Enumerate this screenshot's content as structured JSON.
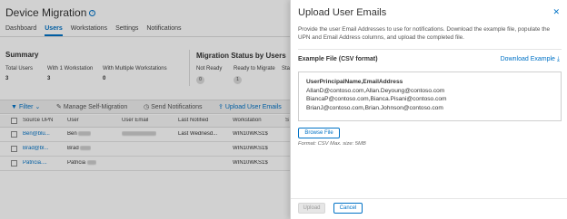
{
  "page": {
    "title": "Device Migration",
    "tabs": [
      {
        "label": "Dashboard",
        "active": false
      },
      {
        "label": "Users",
        "active": true
      },
      {
        "label": "Workstations",
        "active": false
      },
      {
        "label": "Settings",
        "active": false
      },
      {
        "label": "Notifications",
        "active": false
      }
    ]
  },
  "summary": {
    "title": "Summary",
    "stats": [
      {
        "label": "Total Users",
        "value": "3"
      },
      {
        "label": "With 1 Workstation",
        "value": "3"
      },
      {
        "label": "With Multiple Workstations",
        "value": "0"
      }
    ]
  },
  "migration_status": {
    "title": "Migration Status by Users",
    "items": [
      {
        "label": "Not Ready",
        "value": "0"
      },
      {
        "label": "Ready to Migrate",
        "value": "1"
      },
      {
        "label": "Sta",
        "value": ""
      }
    ]
  },
  "toolbar": {
    "filter": "Filter",
    "manage": "Manage Self-Migration",
    "send": "Send Notifications",
    "upload": "Upload User Emails"
  },
  "table": {
    "columns": [
      "Source UPN",
      "User",
      "User Email",
      "Last Notified",
      "Workstation",
      "S"
    ],
    "rows": [
      {
        "upn": "Ben@blu...",
        "user": "Ben",
        "email": "",
        "notified": "Last Wednesd...",
        "workstation": "WIN10WKS1$"
      },
      {
        "upn": "Brad@bl...",
        "user": "Brad",
        "email": "",
        "notified": "",
        "workstation": "WIN10WKS1$"
      },
      {
        "upn": "Patricia....",
        "user": "Patricia",
        "email": "",
        "notified": "",
        "workstation": "WIN10WKS1$"
      }
    ]
  },
  "panel": {
    "title": "Upload User Emails",
    "description": "Provide the user Email Addresses to use for notifications. Download the example file, populate the UPN and Email Address columns, and upload the completed file.",
    "example_label": "Example File (CSV format)",
    "download_label": "Download Example",
    "csv_lines": [
      "UserPrincipalName,EmailAddress",
      "AllanD@contoso.com,Allan.Deyoung@contoso.com",
      "BiancaP@contoso.com,Bianca.Pisani@contoso.com",
      "BrianJ@contoso.com,Brian.Johnson@contoso.com"
    ],
    "browse_label": "Browse File",
    "format_hint": "Format: CSV Max. size: 5MB",
    "upload_label": "Upload",
    "cancel_label": "Cancel"
  },
  "colors": {
    "accent": "#0072c6",
    "overlay": "rgba(0,0,0,0.18)"
  }
}
